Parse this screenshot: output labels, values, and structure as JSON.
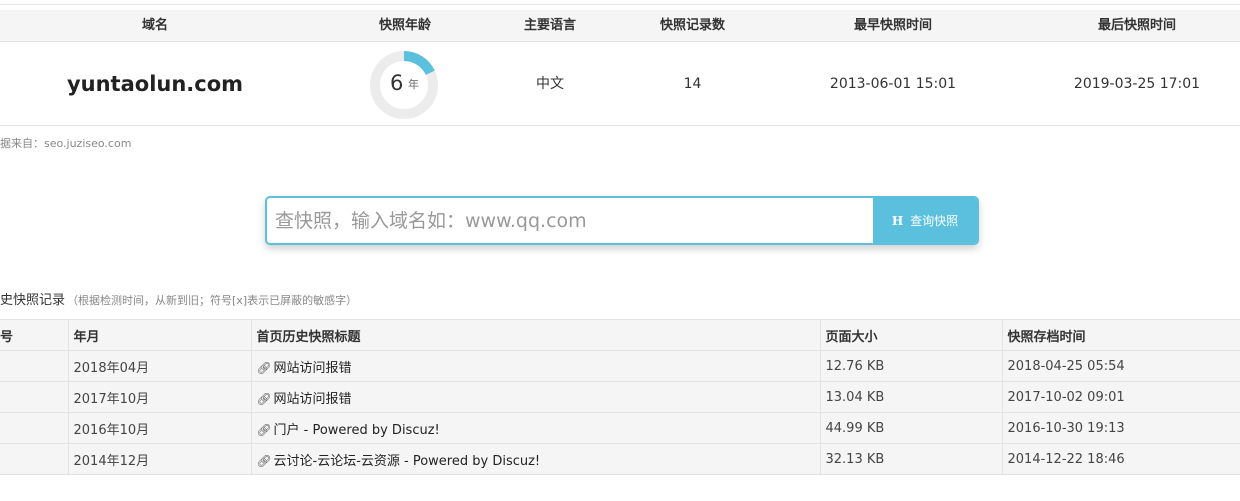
{
  "summary": {
    "headers": [
      "域名",
      "快照年龄",
      "主要语言",
      "快照记录数",
      "最早快照时间",
      "最后快照时间"
    ],
    "domain": "yuntaolun.com",
    "age": {
      "value": "6",
      "unit": "年",
      "ring_fraction": 0.18
    },
    "language": "中文",
    "record_count": "14",
    "earliest": "2013-06-01 15:01",
    "latest": "2019-03-25 17:01"
  },
  "source_note": "据来自：seo.juziseo.com",
  "search": {
    "placeholder": "查快照，输入域名如：www.qq.com",
    "button_icon": "H",
    "button_label": "查询快照"
  },
  "history": {
    "title": "史快照记录",
    "hint": "（根据检测时间，从新到旧；符号[x]表示已屏蔽的敏感字）",
    "columns": [
      "号",
      "年月",
      "首页历史快照标题",
      "页面大小",
      "快照存档时间"
    ],
    "rows": [
      {
        "month": "2018年04月",
        "title": "网站访问报错",
        "size": "12.76 KB",
        "time": "2018-04-25 05:54"
      },
      {
        "month": "2017年10月",
        "title": "网站访问报错",
        "size": "13.04 KB",
        "time": "2017-10-02 09:01"
      },
      {
        "month": "2016年10月",
        "title": "门户 - Powered by Discuz!",
        "size": "44.99 KB",
        "time": "2016-10-30 19:13"
      },
      {
        "month": "2014年12月",
        "title": "云讨论-云论坛-云资源 - Powered by Discuz!",
        "size": "32.13 KB",
        "time": "2014-12-22 18:46"
      }
    ]
  },
  "colors": {
    "accent": "#5bc0de",
    "ring_track": "#ececec",
    "header_bg": "#f5f5f5"
  }
}
